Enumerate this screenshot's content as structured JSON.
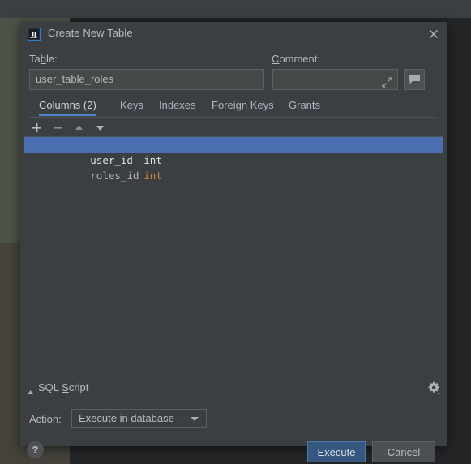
{
  "window": {
    "title": "Create New Table",
    "app_icon": "intellij-idea-icon",
    "close_icon": "close-icon"
  },
  "form": {
    "table_label": "Table:",
    "table_label_mnemonic": "b",
    "table_value": "user_table_roles",
    "comment_label": "Comment:",
    "comment_label_mnemonic": "C",
    "comment_value": "",
    "comment_placeholder": "",
    "expand_icon": "expand-icon",
    "comment_button_icon": "comment-bubble-icon"
  },
  "tabs": [
    {
      "label": "Columns (2)",
      "active": true
    },
    {
      "label": "Keys",
      "active": false
    },
    {
      "label": "Indexes",
      "active": false
    },
    {
      "label": "Foreign Keys",
      "active": false
    },
    {
      "label": "Grants",
      "active": false
    }
  ],
  "toolbar": {
    "add_icon": "plus-icon",
    "remove_icon": "minus-icon",
    "move_up_icon": "arrow-up-icon",
    "move_down_icon": "arrow-down-icon"
  },
  "columns": [
    {
      "name": "user_id",
      "type": "int",
      "selected": true
    },
    {
      "name": "roles_id",
      "type": "int",
      "selected": false
    }
  ],
  "sql_script": {
    "label": "SQL Script",
    "label_mnemonic": "S",
    "collapse_icon": "triangle-up-icon",
    "settings_icon": "gear-icon",
    "action_label": "Action:",
    "action_value": "Execute in database",
    "action_options": [
      "Execute in database"
    ]
  },
  "footer": {
    "help_label": "?",
    "execute_label": "Execute",
    "cancel_label": "Cancel"
  },
  "colors": {
    "dialog_bg": "#3c3f41",
    "accent_blue": "#4a88c7",
    "selection_blue": "#4b6eb0",
    "default_button_blue": "#365880",
    "type_orange": "#cc8242",
    "text": "#bbbbbb"
  }
}
